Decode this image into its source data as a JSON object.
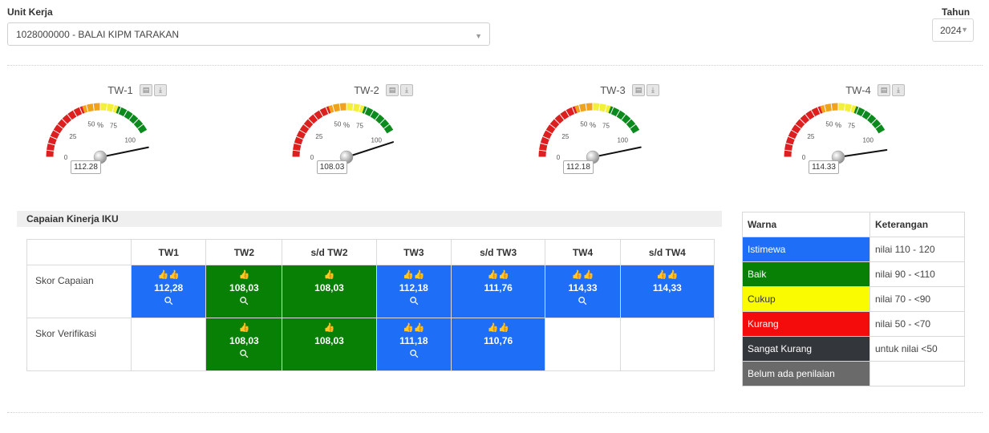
{
  "filters": {
    "unit_label": "Unit Kerja",
    "unit_value": "1028000000 - BALAI KIPM TARAKAN",
    "tahun_label": "Tahun",
    "tahun_value": "2024"
  },
  "gauges": [
    {
      "title": "TW-1",
      "value": 112.28,
      "value_text": "112.28"
    },
    {
      "title": "TW-2",
      "value": 108.03,
      "value_text": "108.03"
    },
    {
      "title": "TW-3",
      "value": 112.18,
      "value_text": "112.18"
    },
    {
      "title": "TW-4",
      "value": 114.33,
      "value_text": "114.33"
    }
  ],
  "gauge_scale": {
    "ticks": [
      "0",
      "25",
      "50",
      "75",
      "100"
    ],
    "unit": "%",
    "min": 0,
    "max": 100
  },
  "gauge_band_colors": {
    "red": "#dd1f1f",
    "orange": "#f0a31a",
    "yellow": "#f4f03a",
    "green": "#0b8a1d"
  },
  "iku": {
    "title": "Capaian Kinerja IKU",
    "headers": [
      "",
      "TW1",
      "TW2",
      "s/d TW2",
      "TW3",
      "s/d TW3",
      "TW4",
      "s/d TW4"
    ],
    "rows": [
      {
        "label": "Skor Capaian",
        "cells": [
          {
            "color": "blue",
            "thumbs": "👍👍",
            "value": "112,28",
            "search": true
          },
          {
            "color": "green",
            "thumbs": "👍",
            "value": "108,03",
            "search": true
          },
          {
            "color": "green",
            "thumbs": "👍",
            "value": "108,03",
            "search": false
          },
          {
            "color": "blue",
            "thumbs": "👍👍",
            "value": "112,18",
            "search": true
          },
          {
            "color": "blue",
            "thumbs": "👍👍",
            "value": "111,76",
            "search": false
          },
          {
            "color": "blue",
            "thumbs": "👍👍",
            "value": "114,33",
            "search": true
          },
          {
            "color": "blue",
            "thumbs": "👍👍",
            "value": "114,33",
            "search": false
          }
        ]
      },
      {
        "label": "Skor Verifikasi",
        "cells": [
          {
            "color": "empty"
          },
          {
            "color": "green",
            "thumbs": "👍",
            "value": "108,03",
            "search": true
          },
          {
            "color": "green",
            "thumbs": "👍",
            "value": "108,03",
            "search": false
          },
          {
            "color": "blue",
            "thumbs": "👍👍",
            "value": "111,18",
            "search": true
          },
          {
            "color": "blue",
            "thumbs": "👍👍",
            "value": "110,76",
            "search": false
          },
          {
            "color": "empty"
          },
          {
            "color": "empty"
          }
        ]
      }
    ]
  },
  "legend": {
    "headers": [
      "Warna",
      "Keterangan"
    ],
    "rows": [
      {
        "label": "Istimewa",
        "color": "#1e6ef7",
        "text_color": "#ffffff",
        "desc": "nilai 110 - 120"
      },
      {
        "label": "Baik",
        "color": "#088005",
        "text_color": "#ffffff",
        "desc": "nilai 90 - <110"
      },
      {
        "label": "Cukup",
        "color": "#fbfb00",
        "text_color": "#333333",
        "desc": "nilai 70 - <90"
      },
      {
        "label": "Kurang",
        "color": "#f40b0b",
        "text_color": "#ffffff",
        "desc": "nilai 50 - <70"
      },
      {
        "label": "Sangat Kurang",
        "color": "#33363a",
        "text_color": "#ffffff",
        "desc": "untuk nilai <50"
      },
      {
        "label": "Belum ada penilaian",
        "color": "#6a6a6a",
        "text_color": "#ffffff",
        "desc": ""
      }
    ]
  },
  "icons": {
    "thumbs_up": "thumbs-up-icon",
    "search": "search-icon",
    "print": "print-icon",
    "download": "download-icon",
    "caret": "caret-down-icon"
  }
}
